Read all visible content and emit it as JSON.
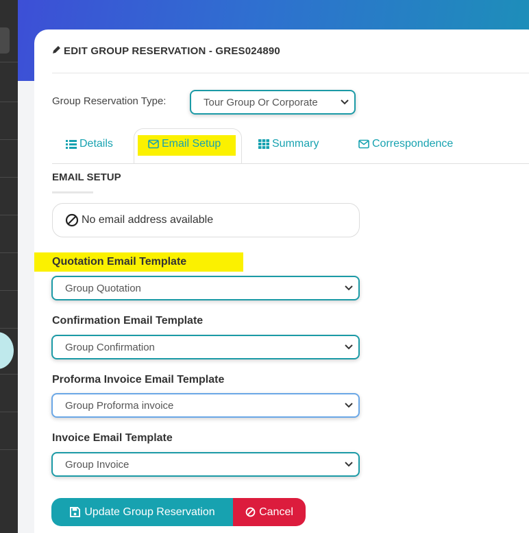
{
  "modal": {
    "title": "EDIT GROUP RESERVATION - GRES024890"
  },
  "reservation_type": {
    "label": "Group Reservation Type:",
    "value": "Tour Group Or Corporate"
  },
  "tabs": [
    {
      "label": "Details",
      "icon": "list-icon"
    },
    {
      "label": "Email Setup",
      "icon": "envelope-icon",
      "active": true
    },
    {
      "label": "Summary",
      "icon": "grid-icon"
    },
    {
      "label": "Correspondence",
      "icon": "envelope-icon"
    }
  ],
  "email_setup": {
    "heading": "EMAIL SETUP",
    "no_email_text": "No email address available",
    "quotation": {
      "label": "Quotation Email Template",
      "value": "Group Quotation"
    },
    "confirmation": {
      "label": "Confirmation Email Template",
      "value": "Group Confirmation"
    },
    "proforma": {
      "label": "Proforma Invoice Email Template",
      "value": "Group Proforma invoice"
    },
    "invoice": {
      "label": "Invoice Email Template",
      "value": "Group Invoice"
    }
  },
  "actions": {
    "update_label": "Update Group Reservation",
    "cancel_label": "Cancel"
  },
  "colors": {
    "accent": "#17a2b0",
    "danger": "#dc1c3d",
    "highlight": "#fbf100"
  }
}
